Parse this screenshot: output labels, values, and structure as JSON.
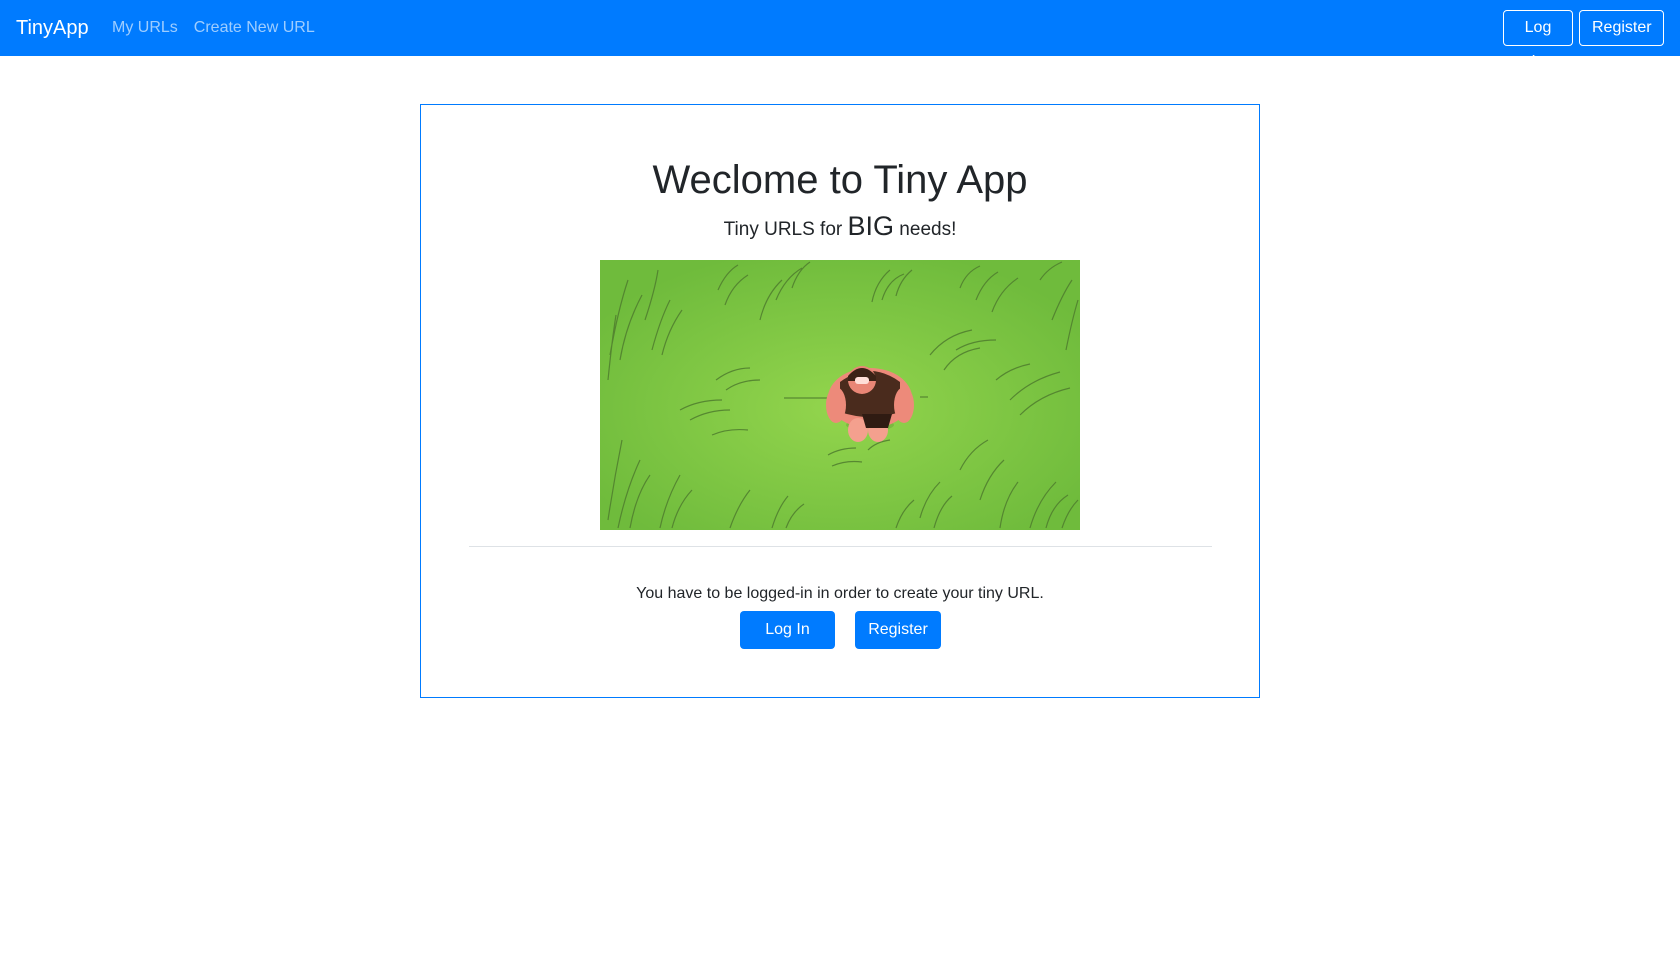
{
  "navbar": {
    "brand": "TinyApp",
    "links": [
      "My URLs",
      "Create New URL"
    ],
    "login_label": "Log In",
    "register_label": "Register",
    "background": "#007bff"
  },
  "main": {
    "title": "Weclome to Tiny App",
    "subtitle_prefix": "Tiny URLS for ",
    "subtitle_big": "BIG",
    "subtitle_suffix": " needs!",
    "image_icon": "cartoon-caveman-in-grass",
    "message": "You have to be logged-in in order to create your tiny URL.",
    "login_label": "Log In",
    "register_label": "Register",
    "accent": "#007bff"
  }
}
